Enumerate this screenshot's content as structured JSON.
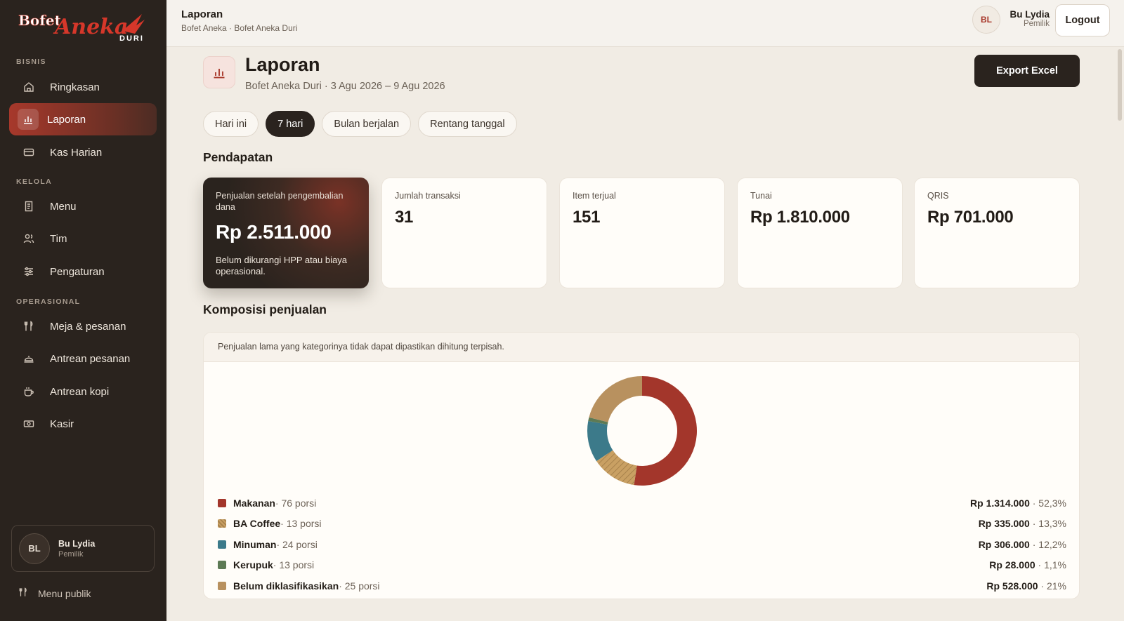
{
  "sidebar": {
    "logo_line1": "Bofet",
    "logo_line2": "Aneka",
    "logo_line3": "DURI",
    "sections": [
      {
        "label": "BISNIS"
      },
      {
        "label": "KELOLA"
      },
      {
        "label": "OPERASIONAL"
      }
    ],
    "items": [
      {
        "label": "Ringkasan",
        "icon": "home-icon"
      },
      {
        "label": "Laporan",
        "icon": "bar-chart-icon",
        "active": true
      },
      {
        "label": "Kas Harian",
        "icon": "card-icon"
      },
      {
        "label": "Menu",
        "icon": "receipt-icon"
      },
      {
        "label": "Tim",
        "icon": "users-icon"
      },
      {
        "label": "Pengaturan",
        "icon": "sliders-icon"
      },
      {
        "label": "Meja & pesanan",
        "icon": "utensils-icon"
      },
      {
        "label": "Antrean pesanan",
        "icon": "cloche-icon"
      },
      {
        "label": "Antrean kopi",
        "icon": "coffee-icon"
      },
      {
        "label": "Kasir",
        "icon": "cash-icon"
      }
    ],
    "user": {
      "initials": "BL",
      "name": "Bu Lydia",
      "role": "Pemilik"
    },
    "public_menu": "Menu publik"
  },
  "topbar": {
    "title": "Laporan",
    "breadcrumb": "Bofet Aneka · Bofet Aneka Duri",
    "user_initials": "BL",
    "user_name": "Bu Lydia",
    "user_role": "Pemilik",
    "logout_label": "Logout"
  },
  "page": {
    "title": "Laporan",
    "subtitle": "Bofet Aneka Duri · 3 Agu 2026 – 9 Agu 2026",
    "export_label": "Export Excel",
    "tabs": [
      {
        "label": "Hari ini",
        "active": false
      },
      {
        "label": "7 hari",
        "active": true
      },
      {
        "label": "Bulan berjalan",
        "active": false
      },
      {
        "label": "Rentang tanggal",
        "active": false
      }
    ]
  },
  "revenue": {
    "section_title": "Pendapatan",
    "hero": {
      "label": "Penjualan setelah pengembalian dana",
      "value": "Rp 2.511.000",
      "note": "Belum dikurangi HPP atau biaya operasional."
    },
    "cards": [
      {
        "label": "Jumlah transaksi",
        "value": "31"
      },
      {
        "label": "Item terjual",
        "value": "151"
      },
      {
        "label": "Tunai",
        "value": "Rp 1.810.000"
      },
      {
        "label": "QRIS",
        "value": "Rp 701.000"
      }
    ]
  },
  "composition": {
    "section_title": "Komposisi penjualan",
    "note": "Penjualan lama yang kategorinya tidak dapat dipastikan dihitung terpisah.",
    "colors": {
      "makanan": "#a3362b",
      "ba_coffee": "#c9a063",
      "minuman": "#3c7a8a",
      "kerupuk": "#5d7a55",
      "belum": "#b8915f"
    },
    "items": [
      {
        "name": "Makanan",
        "meta": " · 76 porsi",
        "amount": "Rp 1.314.000",
        "pct_label": " · 52,3%"
      },
      {
        "name": "BA Coffee",
        "meta": " · 13 porsi",
        "amount": "Rp 335.000",
        "pct_label": " · 13,3%"
      },
      {
        "name": "Minuman",
        "meta": " · 24 porsi",
        "amount": "Rp 306.000",
        "pct_label": " · 12,2%"
      },
      {
        "name": "Kerupuk",
        "meta": " · 13 porsi",
        "amount": "Rp 28.000",
        "pct_label": " · 1,1%"
      },
      {
        "name": "Belum diklasifikasikan",
        "meta": " · 25 porsi",
        "amount": "Rp 528.000",
        "pct_label": " · 21%"
      }
    ]
  },
  "chart_data": {
    "type": "pie",
    "categories": [
      "Makanan",
      "BA Coffee",
      "Minuman",
      "Kerupuk",
      "Belum diklasifikasikan"
    ],
    "values": [
      52.3,
      13.3,
      12.2,
      1.1,
      21
    ]
  }
}
